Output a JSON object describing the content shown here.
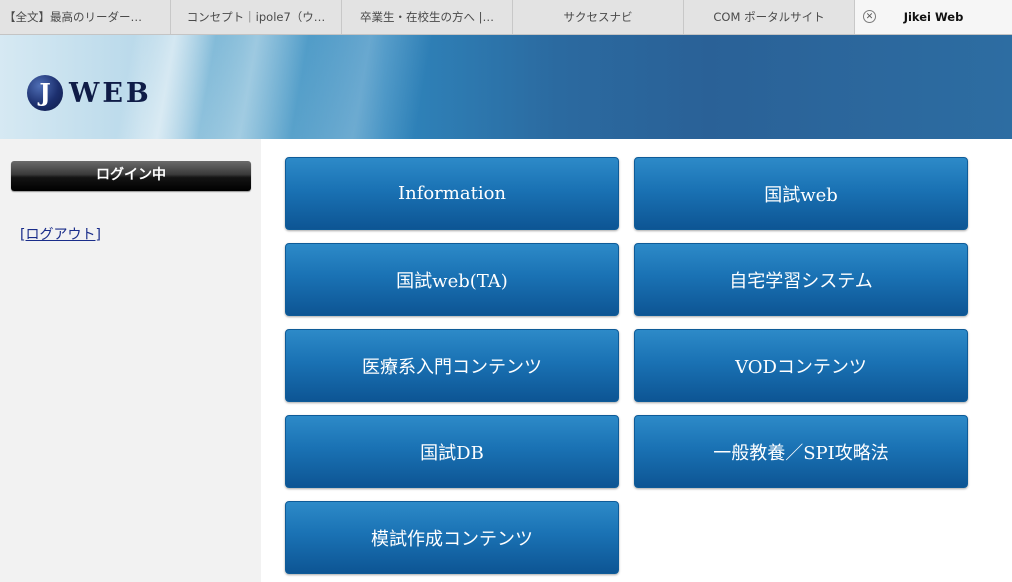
{
  "browser": {
    "tabs": [
      {
        "label": "【全文】最高のリーダー…"
      },
      {
        "label": "コンセプト｜ipole7（ウ…"
      },
      {
        "label": "卒業生・在校生の方へ |…"
      },
      {
        "label": "サクセスナビ"
      },
      {
        "label": "COM ポータルサイト"
      },
      {
        "label": "Jikei Web",
        "active": true
      }
    ],
    "close_icon": "close-circle-icon"
  },
  "header": {
    "logo_mark": "J",
    "logo_text": "WEB"
  },
  "sidebar": {
    "status": "ログイン中",
    "logout": "[ログアウト]"
  },
  "menu": [
    {
      "label": "Information"
    },
    {
      "label": "国試web"
    },
    {
      "label": "国試web(TA)"
    },
    {
      "label": "自宅学習システム"
    },
    {
      "label": "医療系入門コンテンツ"
    },
    {
      "label": "VODコンテンツ"
    },
    {
      "label": "国試DB"
    },
    {
      "label": "一般教養／SPI攻略法"
    },
    {
      "label": "模試作成コンテンツ"
    }
  ]
}
